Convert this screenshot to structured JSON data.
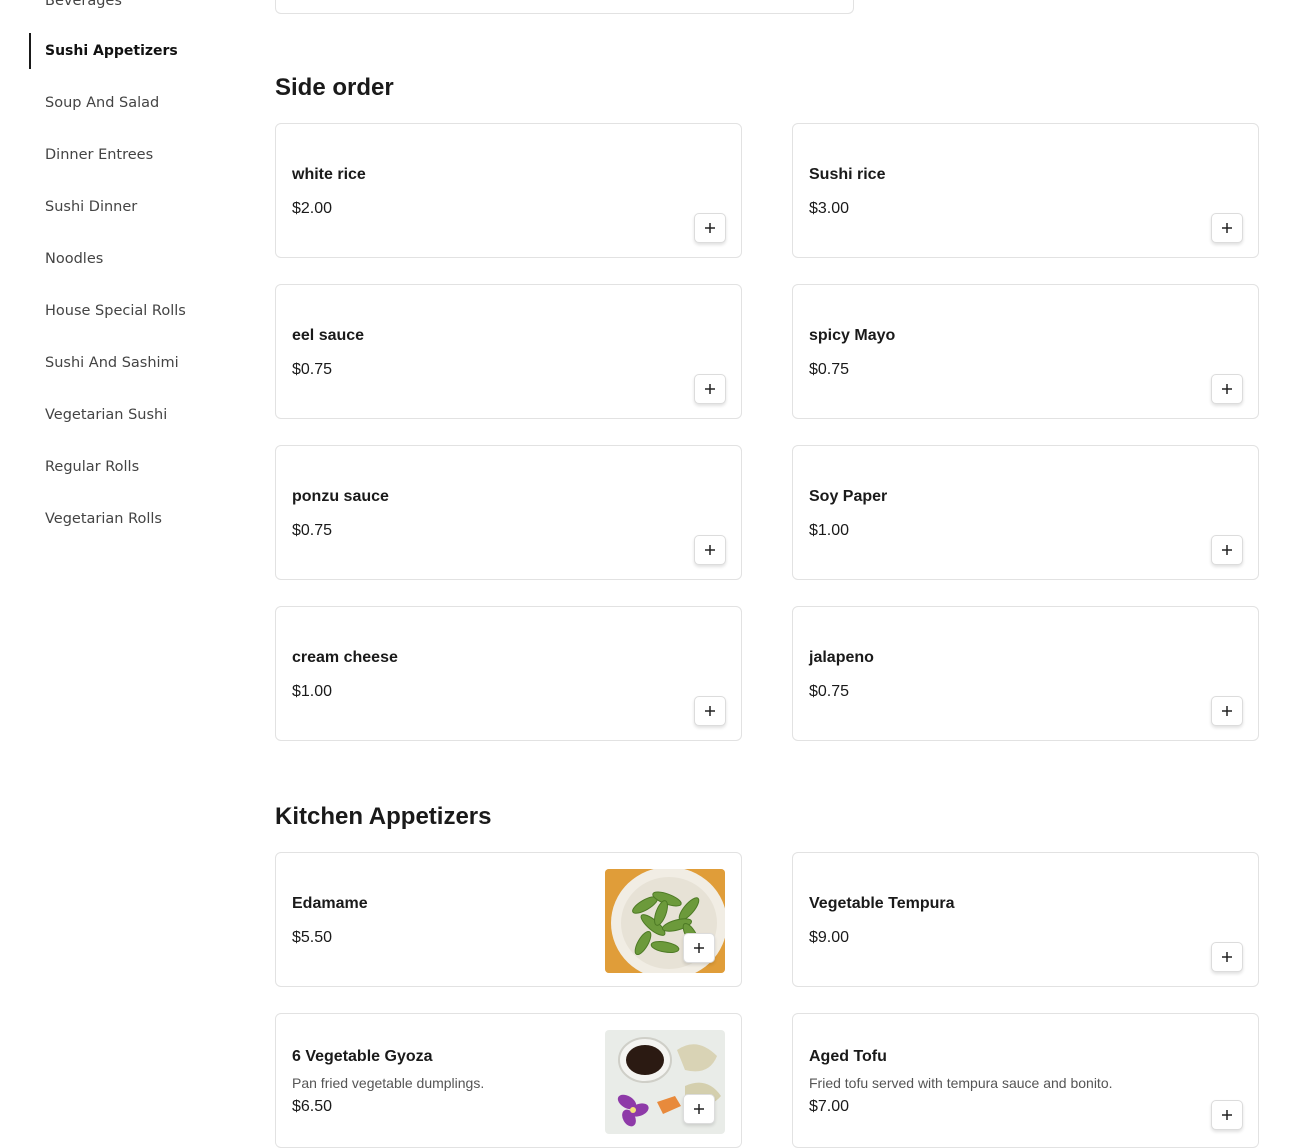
{
  "sidebar": {
    "items": [
      {
        "label": "Beverages"
      },
      {
        "label": "Sushi Appetizers",
        "active": true
      },
      {
        "label": "Soup And Salad"
      },
      {
        "label": "Dinner Entrees"
      },
      {
        "label": "Sushi Dinner"
      },
      {
        "label": "Noodles"
      },
      {
        "label": "House Special Rolls"
      },
      {
        "label": "Sushi And Sashimi"
      },
      {
        "label": "Vegetarian Sushi"
      },
      {
        "label": "Regular Rolls"
      },
      {
        "label": "Vegetarian Rolls"
      }
    ]
  },
  "sections": [
    {
      "title": "Side order",
      "items": [
        {
          "name": "white rice",
          "price": "$2.00"
        },
        {
          "name": "Sushi rice",
          "price": "$3.00"
        },
        {
          "name": "eel sauce",
          "price": "$0.75"
        },
        {
          "name": "spicy Mayo",
          "price": "$0.75"
        },
        {
          "name": "ponzu sauce",
          "price": "$0.75"
        },
        {
          "name": "Soy Paper",
          "price": "$1.00"
        },
        {
          "name": "cream cheese",
          "price": "$1.00"
        },
        {
          "name": "jalapeno",
          "price": "$0.75"
        }
      ]
    },
    {
      "title": "Kitchen Appetizers",
      "items": [
        {
          "name": "Edamame",
          "price": "$5.50",
          "image": "edamame-photo"
        },
        {
          "name": "Vegetable Tempura",
          "price": "$9.00"
        },
        {
          "name": "6 Vegetable Gyoza",
          "description": "Pan fried vegetable dumplings.",
          "price": "$6.50",
          "image": "gyoza-photo"
        },
        {
          "name": "Aged Tofu",
          "description": "Fried tofu served with tempura sauce and bonito.",
          "price": "$7.00"
        }
      ]
    }
  ],
  "icons": {
    "add": "plus-icon"
  },
  "colors": {
    "text": "#1a1a1a",
    "border": "#e2e2e2",
    "active_indicator": "#1a1a1a"
  }
}
